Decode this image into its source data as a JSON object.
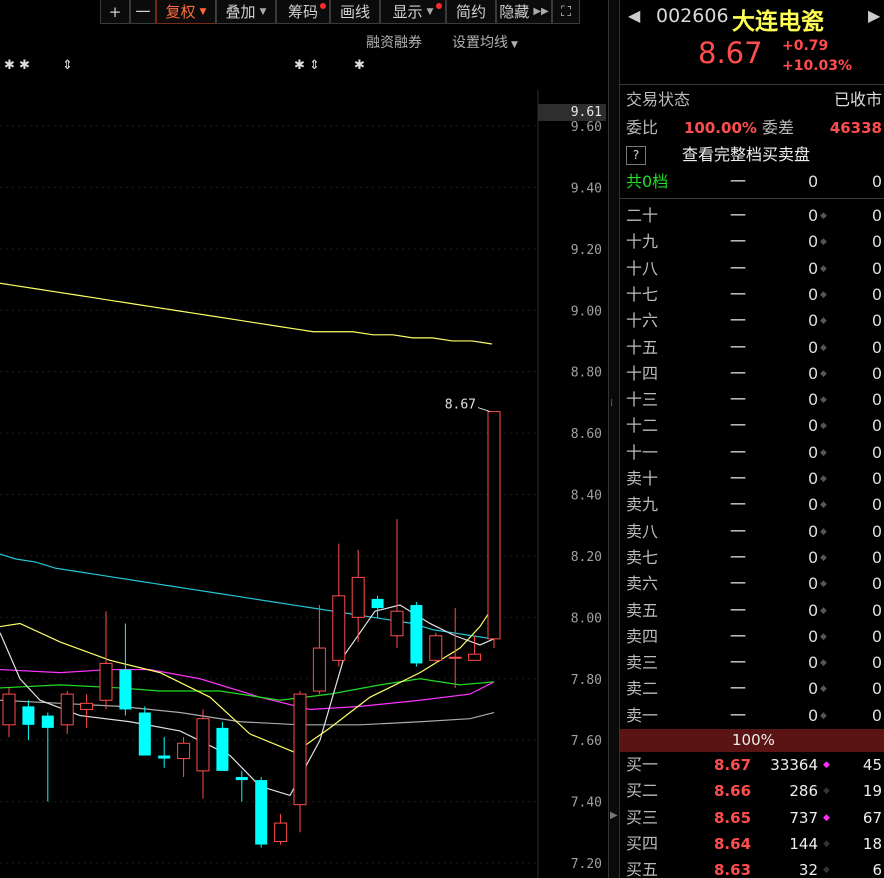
{
  "toolbar": {
    "plus": "+",
    "minus": "一",
    "fuquan": "复权",
    "diejia": "叠加",
    "chouma": "筹码",
    "huaxian": "画线",
    "xianshi": "显示",
    "jianyue": "简约",
    "yincang": "隐藏",
    "expand_icon": "expand-icon"
  },
  "subbar": {
    "rongzi": "融资融券",
    "junxian": "设置均线"
  },
  "markers": {
    "left": "✱ ✱",
    "arrow1": "⇕",
    "mid": "✱ ⇕",
    "right": "✱"
  },
  "price_tag": "9.61",
  "last_price_label": "8.67",
  "colors": {
    "up": "#ff4d4d",
    "down": "#00ffff",
    "ma_yellow": "#ffff66",
    "ma_white": "#e0e0e0",
    "ma_magenta": "#ff33ff",
    "ma_green": "#22dd22",
    "ma_cyan": "#22c8d8",
    "ma_grey": "#aaaaaa"
  },
  "chart_data": {
    "type": "candlestick",
    "ylim": [
      7.16,
      9.64
    ],
    "yticks": [
      "9.60",
      "9.40",
      "9.20",
      "9.00",
      "8.80",
      "8.60",
      "8.40",
      "8.20",
      "8.00",
      "7.80",
      "7.60",
      "7.40",
      "7.20"
    ],
    "candles": [
      {
        "o": 7.65,
        "c": 7.75,
        "h": 7.77,
        "l": 7.61
      },
      {
        "o": 7.71,
        "c": 7.65,
        "h": 7.73,
        "l": 7.6
      },
      {
        "o": 7.68,
        "c": 7.64,
        "h": 7.69,
        "l": 7.4
      },
      {
        "o": 7.65,
        "c": 7.75,
        "h": 7.76,
        "l": 7.62
      },
      {
        "o": 7.7,
        "c": 7.72,
        "h": 7.75,
        "l": 7.64
      },
      {
        "o": 7.73,
        "c": 7.85,
        "h": 8.02,
        "l": 7.7
      },
      {
        "o": 7.83,
        "c": 7.7,
        "h": 7.98,
        "l": 7.68
      },
      {
        "o": 7.69,
        "c": 7.55,
        "h": 7.71,
        "l": 7.55
      },
      {
        "o": 7.55,
        "c": 7.54,
        "h": 7.61,
        "l": 7.51
      },
      {
        "o": 7.54,
        "c": 7.59,
        "h": 7.61,
        "l": 7.48
      },
      {
        "o": 7.5,
        "c": 7.67,
        "h": 7.7,
        "l": 7.41
      },
      {
        "o": 7.64,
        "c": 7.5,
        "h": 7.66,
        "l": 7.5
      },
      {
        "o": 7.48,
        "c": 7.47,
        "h": 7.5,
        "l": 7.4
      },
      {
        "o": 7.47,
        "c": 7.26,
        "h": 7.48,
        "l": 7.25
      },
      {
        "o": 7.27,
        "c": 7.33,
        "h": 7.36,
        "l": 7.26
      },
      {
        "o": 7.39,
        "c": 7.75,
        "h": 7.76,
        "l": 7.3
      },
      {
        "o": 7.76,
        "c": 7.9,
        "h": 8.04,
        "l": 7.75
      },
      {
        "o": 7.86,
        "c": 8.07,
        "h": 8.24,
        "l": 7.84
      },
      {
        "o": 8.0,
        "c": 8.13,
        "h": 8.22,
        "l": 7.92
      },
      {
        "o": 8.06,
        "c": 8.03,
        "h": 8.07,
        "l": 8.0
      },
      {
        "o": 7.94,
        "c": 8.02,
        "h": 8.32,
        "l": 7.9
      },
      {
        "o": 8.04,
        "c": 7.85,
        "h": 8.05,
        "l": 7.84
      },
      {
        "o": 7.86,
        "c": 7.94,
        "h": 7.95,
        "l": 7.85
      },
      {
        "o": 7.87,
        "c": 7.87,
        "h": 8.03,
        "l": 7.77
      },
      {
        "o": 7.86,
        "c": 7.88,
        "h": 7.94,
        "l": 7.86
      },
      {
        "o": 7.93,
        "c": 8.67,
        "h": 8.67,
        "l": 7.9
      }
    ],
    "ma": [
      {
        "name": "long",
        "color": "#ffff66",
        "values": [
          9.09,
          9.08,
          9.07,
          9.06,
          9.05,
          9.04,
          9.03,
          9.02,
          9.01,
          9.0,
          8.99,
          8.98,
          8.97,
          8.96,
          8.95,
          8.94,
          8.93,
          8.93,
          8.93,
          8.92,
          8.92,
          8.91,
          8.91,
          8.9,
          8.9,
          8.89
        ]
      },
      {
        "name": "cyan",
        "color": "#22c8d8",
        "values": [
          8.21,
          8.19,
          8.18,
          8.16,
          8.15,
          8.14,
          8.13,
          8.12,
          8.11,
          8.1,
          8.09,
          8.08,
          8.07,
          8.06,
          8.05,
          8.04,
          8.03,
          8.02,
          8.01,
          8.0,
          7.99,
          7.98,
          7.96,
          7.95,
          7.94,
          7.93
        ]
      }
    ]
  },
  "quote": {
    "code": "002606",
    "name": "大连电瓷",
    "price": "8.67",
    "change": "+0.79",
    "change_pct": "+10.03%",
    "status_label": "交易状态",
    "status_value": "已收市",
    "weibi_label": "委比",
    "weibi_value": "100.00%",
    "weicha_label": "委差",
    "weicha_value": "46338",
    "help": "?",
    "full_depth": "查看完整档买卖盘",
    "total_label": "共0档",
    "dash": "一",
    "zero": "0",
    "sell_levels": [
      "二十",
      "十九",
      "十八",
      "十七",
      "十六",
      "十五",
      "十四",
      "十三",
      "十二",
      "十一",
      "卖十",
      "卖九",
      "卖八",
      "卖七",
      "卖六",
      "卖五",
      "卖四",
      "卖三",
      "卖二",
      "卖一"
    ],
    "bar_pct": "100%",
    "buys": [
      {
        "label": "买一",
        "price": "8.67",
        "vol": "33364",
        "extra": "45",
        "dot": true
      },
      {
        "label": "买二",
        "price": "8.66",
        "vol": "286",
        "extra": "19",
        "dot": false
      },
      {
        "label": "买三",
        "price": "8.65",
        "vol": "737",
        "extra": "67",
        "dot": true
      },
      {
        "label": "买四",
        "price": "8.64",
        "vol": "144",
        "extra": "18",
        "dot": false
      },
      {
        "label": "买五",
        "price": "8.63",
        "vol": "32",
        "extra": "6",
        "dot": false
      }
    ]
  }
}
